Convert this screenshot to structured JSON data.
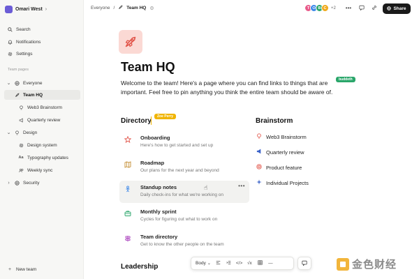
{
  "workspace": {
    "name": "Omari West"
  },
  "sidebar": {
    "top_items": [
      {
        "label": "Search",
        "icon": "search-icon"
      },
      {
        "label": "Notifications",
        "icon": "bell-icon"
      },
      {
        "label": "Settings",
        "icon": "gear-icon"
      }
    ],
    "section_label": "Team pages",
    "tree": {
      "everyone": "Everyone",
      "team_hq": "Team HQ",
      "web3": "Web3 Brainstorm",
      "quarterly": "Quarterly review",
      "design": "Design",
      "design_system": "Design system",
      "typography": "Typography updates",
      "weekly": "Weekly sync",
      "security": "Security"
    },
    "new_team": "New team"
  },
  "topbar": {
    "crumb_parent": "Everyone",
    "crumb_current": "Team HQ",
    "presence": [
      "T",
      "O",
      "B",
      "C"
    ],
    "presence_colors": [
      "#e85a8a",
      "#3a86e8",
      "#2aa66a",
      "#f0a91a"
    ],
    "presence_more": "+2",
    "share_label": "Share"
  },
  "page": {
    "title": "Team HQ",
    "intro": "Welcome to the team! Here's a page where you can find links to things that are important. Feel free to pin anything you think the entire team should be aware of.",
    "cursor_tag_1": "buddeth",
    "cursor_tag_2": "Zoe Perry"
  },
  "directory": {
    "heading": "Directory",
    "items": [
      {
        "title": "Onboarding",
        "desc": "Here's how to get started and set up"
      },
      {
        "title": "Roadmap",
        "desc": "Our plans for the next year and beyond"
      },
      {
        "title": "Standup notes",
        "desc": "Daily check-ins for what we're working on"
      },
      {
        "title": "Monthly sprint",
        "desc": "Cycles for figuring out what to work on"
      },
      {
        "title": "Team directory",
        "desc": "Get to know the other people on the team"
      }
    ],
    "more": "•••"
  },
  "brainstorm": {
    "heading": "Brainstorm",
    "items": [
      {
        "label": "Web3 Brainstorm"
      },
      {
        "label": "Quarterly review"
      },
      {
        "label": "Product feature"
      },
      {
        "label": "Individual Projects"
      }
    ]
  },
  "leadership": {
    "heading": "Leadership"
  },
  "toolbar": {
    "style_label": "Body"
  },
  "watermark": {
    "text": "金色财经"
  },
  "colors": {
    "accent": "#e2574c",
    "tag_green": "#2aa66a",
    "tag_yellow": "#f0b400"
  }
}
